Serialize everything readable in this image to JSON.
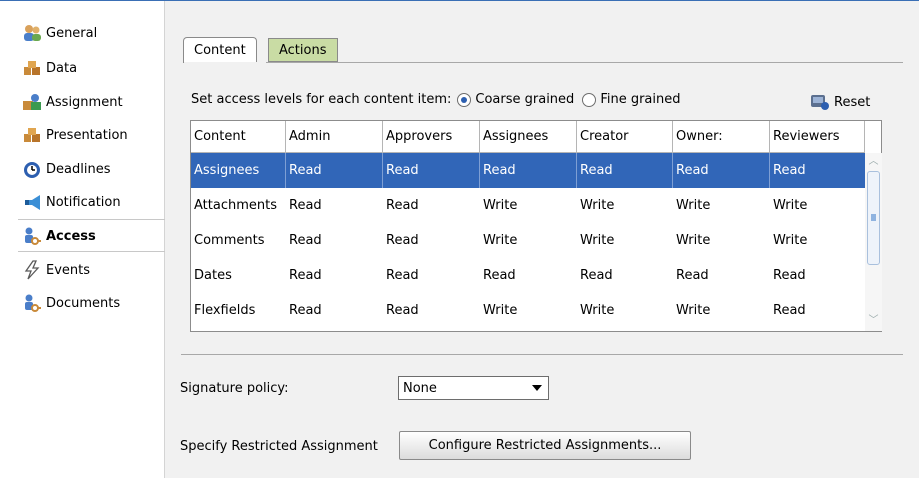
{
  "sidebar": {
    "items": [
      {
        "label": "General",
        "icon": "people-icon"
      },
      {
        "label": "Data",
        "icon": "boxes-icon"
      },
      {
        "label": "Assignment",
        "icon": "assignment-icon"
      },
      {
        "label": "Presentation",
        "icon": "boxes-icon"
      },
      {
        "label": "Deadlines",
        "icon": "clock-icon"
      },
      {
        "label": "Notification",
        "icon": "megaphone-icon"
      },
      {
        "label": "Access",
        "icon": "key-person-icon"
      },
      {
        "label": "Events",
        "icon": "lightning-icon"
      },
      {
        "label": "Documents",
        "icon": "key-person-icon"
      }
    ],
    "active": "Access"
  },
  "tabs": [
    {
      "label": "Content",
      "selected": true
    },
    {
      "label": "Actions",
      "selected": false
    }
  ],
  "access": {
    "instruction": "Set access levels for each content item:",
    "radio_coarse": "Coarse grained",
    "radio_fine": "Fine grained",
    "selected_mode": "Coarse grained",
    "reset_label": "Reset"
  },
  "table": {
    "columns": [
      "Content",
      "Admin",
      "Approvers",
      "Assignees",
      "Creator",
      "Owner:",
      "Reviewers"
    ],
    "rows": [
      [
        "Assignees",
        "Read",
        "Read",
        "Read",
        "Read",
        "Read",
        "Read"
      ],
      [
        "Attachments",
        "Read",
        "Read",
        "Write",
        "Write",
        "Write",
        "Write"
      ],
      [
        "Comments",
        "Read",
        "Read",
        "Write",
        "Write",
        "Write",
        "Write"
      ],
      [
        "Dates",
        "Read",
        "Read",
        "Read",
        "Read",
        "Read",
        "Read"
      ],
      [
        "Flexfields",
        "Read",
        "Read",
        "Write",
        "Write",
        "Write",
        "Read"
      ]
    ],
    "selected_row": 0
  },
  "form": {
    "signature_label": "Signature policy:",
    "signature_value": "None",
    "restricted_label": "Specify Restricted Assignment",
    "restricted_button": "Configure Restricted Assignments..."
  },
  "colors": {
    "selection": "#3166b8",
    "actions_tab": "#c9dca4",
    "panel_bg": "#f1f1f1"
  }
}
